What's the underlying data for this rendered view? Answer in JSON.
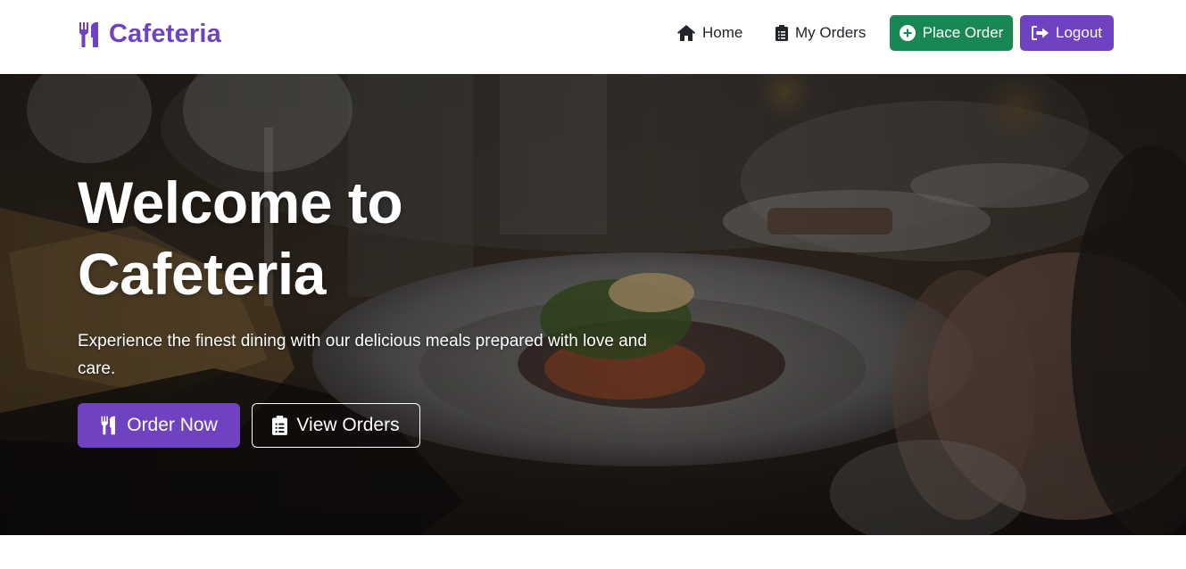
{
  "brand": {
    "name": "Cafeteria",
    "icon": "utensils-icon",
    "color": "#6f42c1"
  },
  "nav": {
    "home": {
      "label": "Home",
      "icon": "home-icon"
    },
    "my_orders": {
      "label": "My Orders",
      "icon": "clipboard-list-icon"
    },
    "place_order": {
      "label": "Place Order",
      "icon": "plus-circle-icon",
      "color": "#198754"
    },
    "logout": {
      "label": "Logout",
      "icon": "sign-out-icon",
      "color": "#6f42c1"
    }
  },
  "hero": {
    "title": "Welcome to Cafeteria",
    "subtitle": "Experience the finest dining with our delicious meals prepared with love and care.",
    "primary_button": {
      "label": "Order Now",
      "icon": "utensils-icon"
    },
    "secondary_button": {
      "label": "View Orders",
      "icon": "clipboard-list-icon"
    }
  }
}
